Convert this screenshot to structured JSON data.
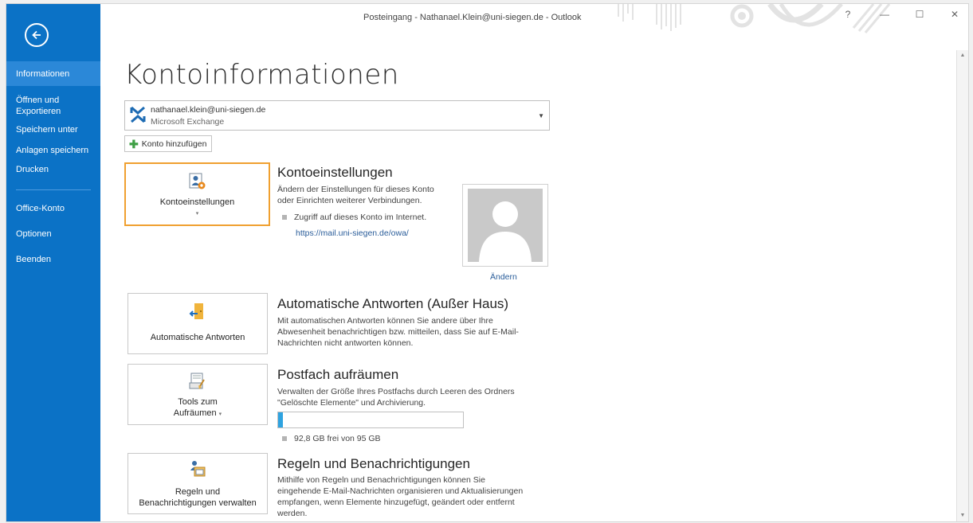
{
  "window": {
    "title": "Posteingang - Nathanael.Klein@uni-siegen.de - Outlook",
    "help_label": "?",
    "minimize_label": "—",
    "restore_label": "☐",
    "close_label": "✕"
  },
  "sidebar": {
    "back_icon": "back-arrow-icon",
    "items": [
      {
        "label": "Informationen",
        "active": true
      },
      {
        "label": "Öffnen und Exportieren"
      },
      {
        "label": "Speichern unter"
      },
      {
        "label": "Anlagen speichern"
      },
      {
        "label": "Drucken"
      },
      {
        "label": "Office-Konto"
      },
      {
        "label": "Optionen"
      },
      {
        "label": "Beenden"
      }
    ]
  },
  "page": {
    "title": "Kontoinformationen",
    "account": {
      "email": "nathanael.klein@uni-siegen.de",
      "type": "Microsoft Exchange"
    },
    "add_account_label": "Konto hinzufügen",
    "sections": {
      "account_settings": {
        "button_label": "Kontoeinstellungen",
        "title": "Kontoeinstellungen",
        "desc_line1": "Ändern der Einstellungen für dieses Konto",
        "desc_line2": "oder Einrichten weiterer Verbindungen.",
        "bullet": "Zugriff auf dieses Konto im Internet.",
        "link": "https://mail.uni-siegen.de/owa/",
        "change_photo": "Ändern"
      },
      "auto_replies": {
        "button_label": "Automatische Antworten",
        "title": "Automatische Antworten (Außer Haus)",
        "desc_line1": "Mit automatischen Antworten können Sie andere über Ihre",
        "desc_line2": "Abwesenheit benachrichtigen bzw. mitteilen, dass Sie auf E-Mail-",
        "desc_line3": "Nachrichten nicht antworten können."
      },
      "cleanup": {
        "button_line1": "Tools zum",
        "button_line2": "Aufräumen",
        "title": "Postfach aufräumen",
        "desc_line1": "Verwalten der Größe Ihres Postfachs durch Leeren des Ordners",
        "desc_line2": "\"Gelöschte Elemente\" und Archivierung.",
        "usage_fraction": 0.024,
        "storage_text": "92,8 GB frei von 95 GB"
      },
      "rules": {
        "button_line1": "Regeln und",
        "button_line2": "Benachrichtigungen verwalten",
        "title": "Regeln und Benachrichtigungen",
        "desc_line1": "Mithilfe von Regeln und Benachrichtigungen können Sie",
        "desc_line2": "eingehende E-Mail-Nachrichten organisieren und Aktualisierungen",
        "desc_line3": "empfangen, wenn Elemente hinzugefügt, geändert oder entfernt",
        "desc_line4": "werden."
      }
    }
  },
  "colors": {
    "sidebar": "#0b72c6",
    "sidebar_active": "#2b88d8",
    "selected_border": "#f0a030",
    "link": "#2a5d9a",
    "progress": "#2fa3e0"
  }
}
